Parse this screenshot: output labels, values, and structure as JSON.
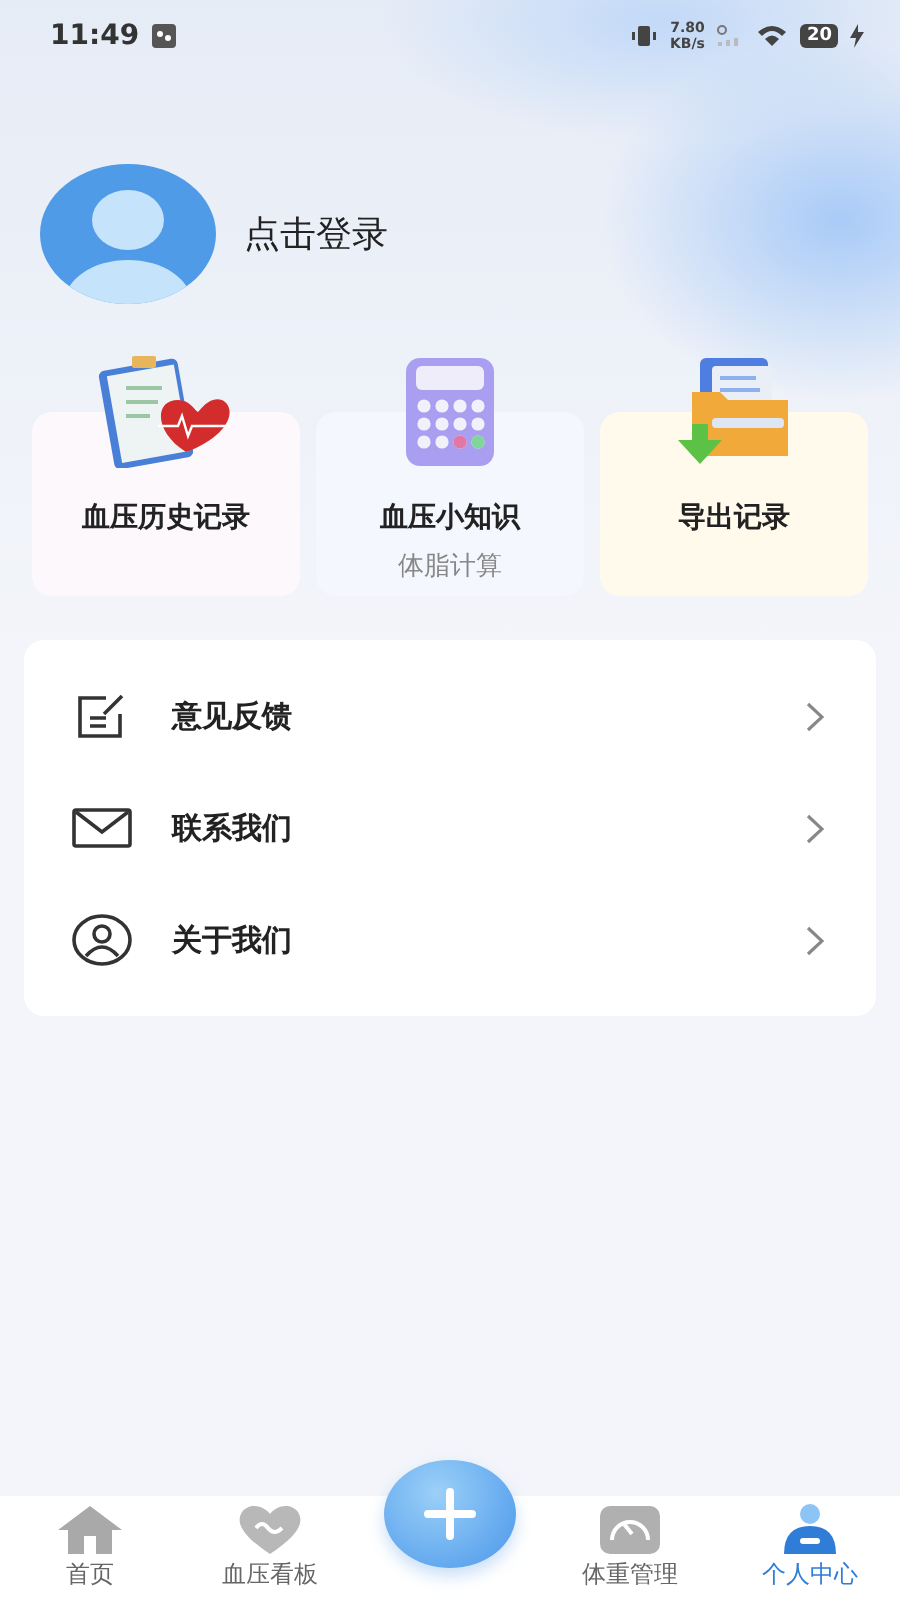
{
  "status_bar": {
    "time": "11:49",
    "speed": "7.80",
    "speed_unit": "KB/s",
    "battery": "20"
  },
  "profile": {
    "login_label": "点击登录"
  },
  "shortcuts": [
    {
      "kind": "history",
      "title": "血压历史记录",
      "color": "#fdf8fc"
    },
    {
      "kind": "calculator",
      "title": "血压小知识",
      "subtitle": "体脂计算",
      "color": "#f4f7fd"
    },
    {
      "kind": "export",
      "title": "导出记录",
      "color": "#fffaec"
    }
  ],
  "menu": [
    {
      "kind": "feedback",
      "label": "意见反馈"
    },
    {
      "kind": "mail",
      "label": "联系我们"
    },
    {
      "kind": "person",
      "label": "关于我们"
    }
  ],
  "tab_bar": [
    {
      "kind": "home",
      "label": "首页",
      "selected": false
    },
    {
      "kind": "heart",
      "label": "血压看板",
      "selected": false
    },
    {
      "kind": "add"
    },
    {
      "kind": "gauge",
      "label": "体重管理",
      "selected": false
    },
    {
      "kind": "user",
      "label": "个人中心",
      "selected": true
    }
  ]
}
